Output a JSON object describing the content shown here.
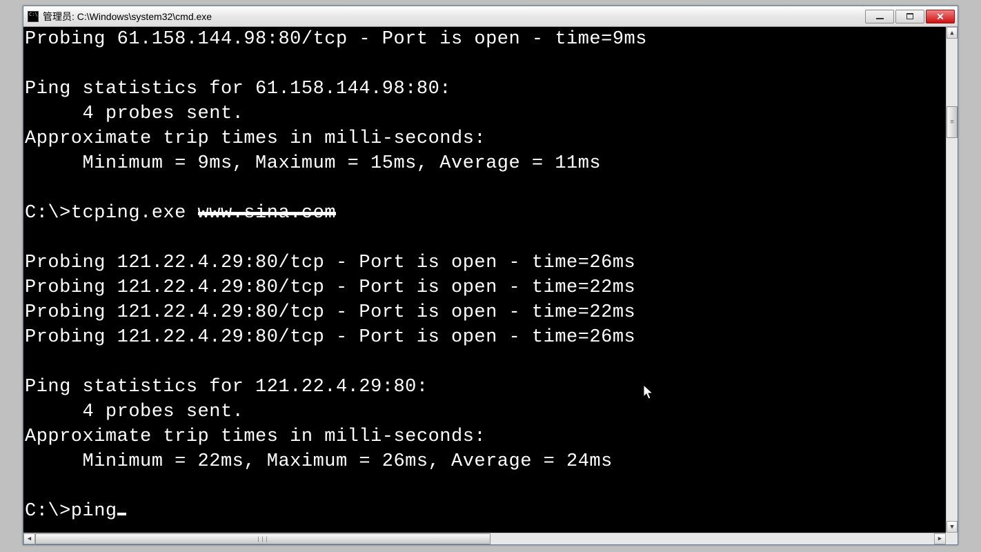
{
  "window": {
    "title": "管理员: C:\\Windows\\system32\\cmd.exe"
  },
  "terminal": {
    "lines": [
      "Probing 61.158.144.98:80/tcp - Port is open - time=9ms",
      "",
      "Ping statistics for 61.158.144.98:80:",
      "     4 probes sent.",
      "Approximate trip times in milli-seconds:",
      "     Minimum = 9ms, Maximum = 15ms, Average = 11ms",
      "",
      "C:\\>tcping.exe ",
      "",
      "Probing 121.22.4.29:80/tcp - Port is open - time=26ms",
      "Probing 121.22.4.29:80/tcp - Port is open - time=22ms",
      "Probing 121.22.4.29:80/tcp - Port is open - time=22ms",
      "Probing 121.22.4.29:80/tcp - Port is open - time=26ms",
      "",
      "Ping statistics for 121.22.4.29:80:",
      "     4 probes sent.",
      "Approximate trip times in milli-seconds:",
      "     Minimum = 22ms, Maximum = 26ms, Average = 24ms",
      "",
      "C:\\>ping"
    ],
    "redacted_text": "www.sina.com"
  }
}
